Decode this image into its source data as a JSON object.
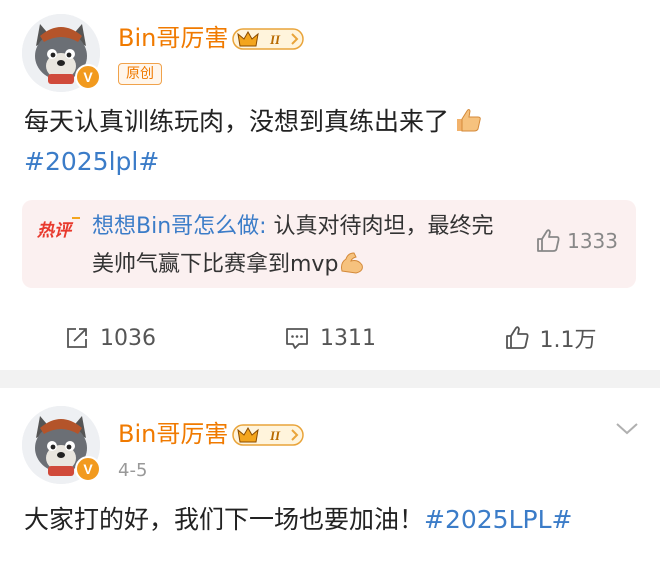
{
  "post1": {
    "username": "Bin哥厉害",
    "verified_letter": "V",
    "tag": "原创",
    "text": "每天认真训练玩肉，没想到真练出来了",
    "hashtag": "#2025lpl#",
    "hot_comment": {
      "label": "热评",
      "user": "想想Bin哥怎么做:",
      "text": " 认真对待肉坦，最终完美帅气赢下比赛拿到mvp",
      "likes": "1333"
    },
    "actions": {
      "repost": "1036",
      "comment": "1311",
      "like": "1.1万"
    }
  },
  "post2": {
    "username": "Bin哥厉害",
    "verified_letter": "V",
    "date": "4-5",
    "text": "大家打的好，我们下一场也要加油！",
    "hashtag": "#2025LPL#"
  },
  "colors": {
    "accent": "#f07a00",
    "link": "#3b7cc8",
    "verified": "#f29a1e",
    "hot_bg": "#fbf0f0"
  },
  "icons": [
    "avatar-wolf",
    "vip-crown-badge",
    "thumbs-up-emoji",
    "hot-comment-label",
    "muscle-emoji",
    "repost-icon",
    "comment-icon",
    "like-icon",
    "chevron-down-icon"
  ]
}
